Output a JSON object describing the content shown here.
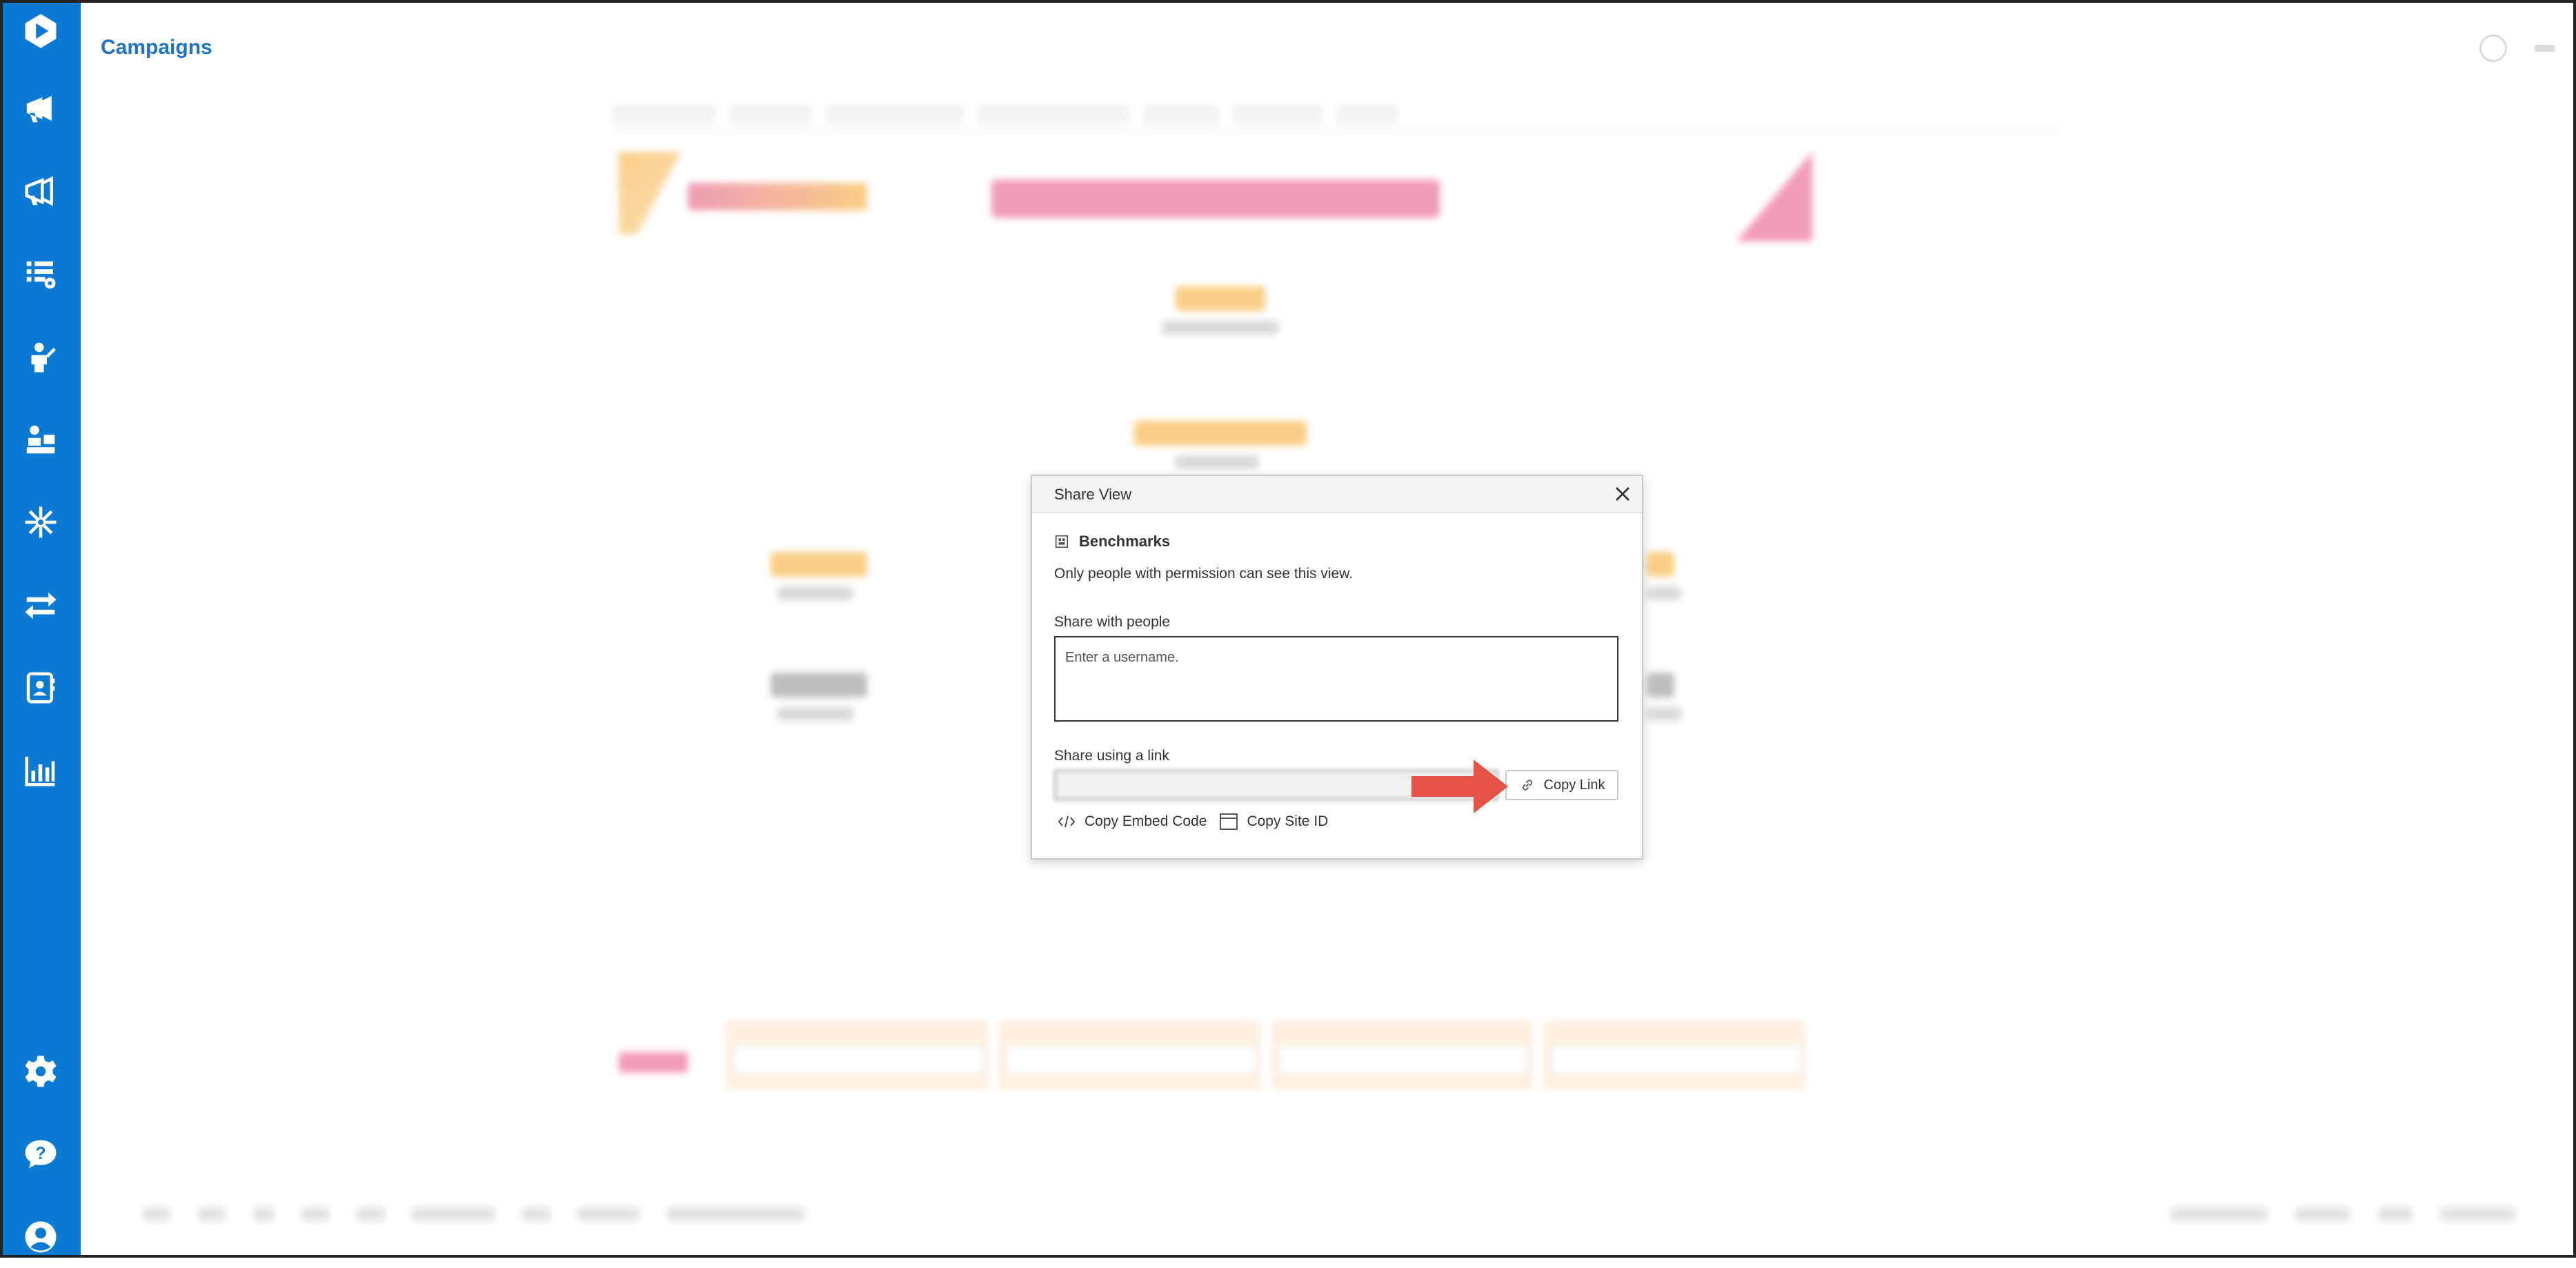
{
  "app": {
    "title": "Campaigns"
  },
  "sidebar": {
    "items": [
      {
        "icon": "logo-icon"
      },
      {
        "icon": "megaphone-icon"
      },
      {
        "icon": "megaphone-outline-icon"
      },
      {
        "icon": "list-settings-icon"
      },
      {
        "icon": "presenter-icon"
      },
      {
        "icon": "learner-icon"
      },
      {
        "icon": "snowflake-icon"
      },
      {
        "icon": "transfer-arrows-icon"
      },
      {
        "icon": "contact-book-icon"
      },
      {
        "icon": "bar-chart-icon"
      },
      {
        "icon": "gear-icon"
      },
      {
        "icon": "help-chat-icon"
      },
      {
        "icon": "user-account-icon"
      }
    ]
  },
  "dialog": {
    "title": "Share View",
    "view_name": "Benchmarks",
    "permission_note": "Only people with permission can see this view.",
    "share_people_label": "Share with people",
    "username_placeholder": "Enter a username.",
    "share_link_label": "Share using a link",
    "copy_link_label": "Copy Link",
    "copy_embed_label": "Copy Embed Code",
    "copy_site_label": "Copy Site ID"
  },
  "colors": {
    "sidebar": "#0a7ad4",
    "title": "#1f73c2",
    "callout_arrow": "#e55347"
  }
}
